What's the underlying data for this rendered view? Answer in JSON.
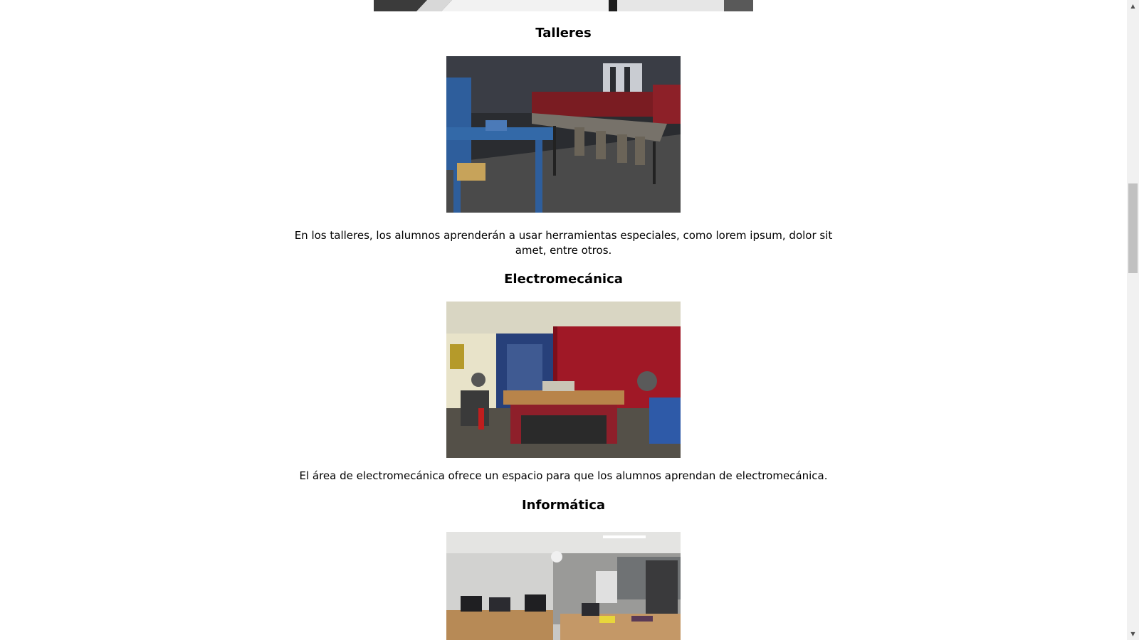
{
  "sections": [
    {
      "title": "Talleres",
      "description": "En los talleres, los alumnos aprenderán a usar herramientas especiales, como lorem ipsum, dolor sit amet, entre otros.",
      "image_subject": "workshop-classroom"
    },
    {
      "title": "Electromecánica",
      "description": "El área de electromecánica ofrece un espacio para que los alumnos aprendan de electromecánica.",
      "image_subject": "electromechanics-workshop"
    },
    {
      "title": "Informática",
      "image_subject": "computer-lab"
    }
  ],
  "scrollbar": {
    "up_icon": "arrow-up-icon",
    "down_icon": "arrow-down-icon",
    "position_fraction": 0.3
  }
}
